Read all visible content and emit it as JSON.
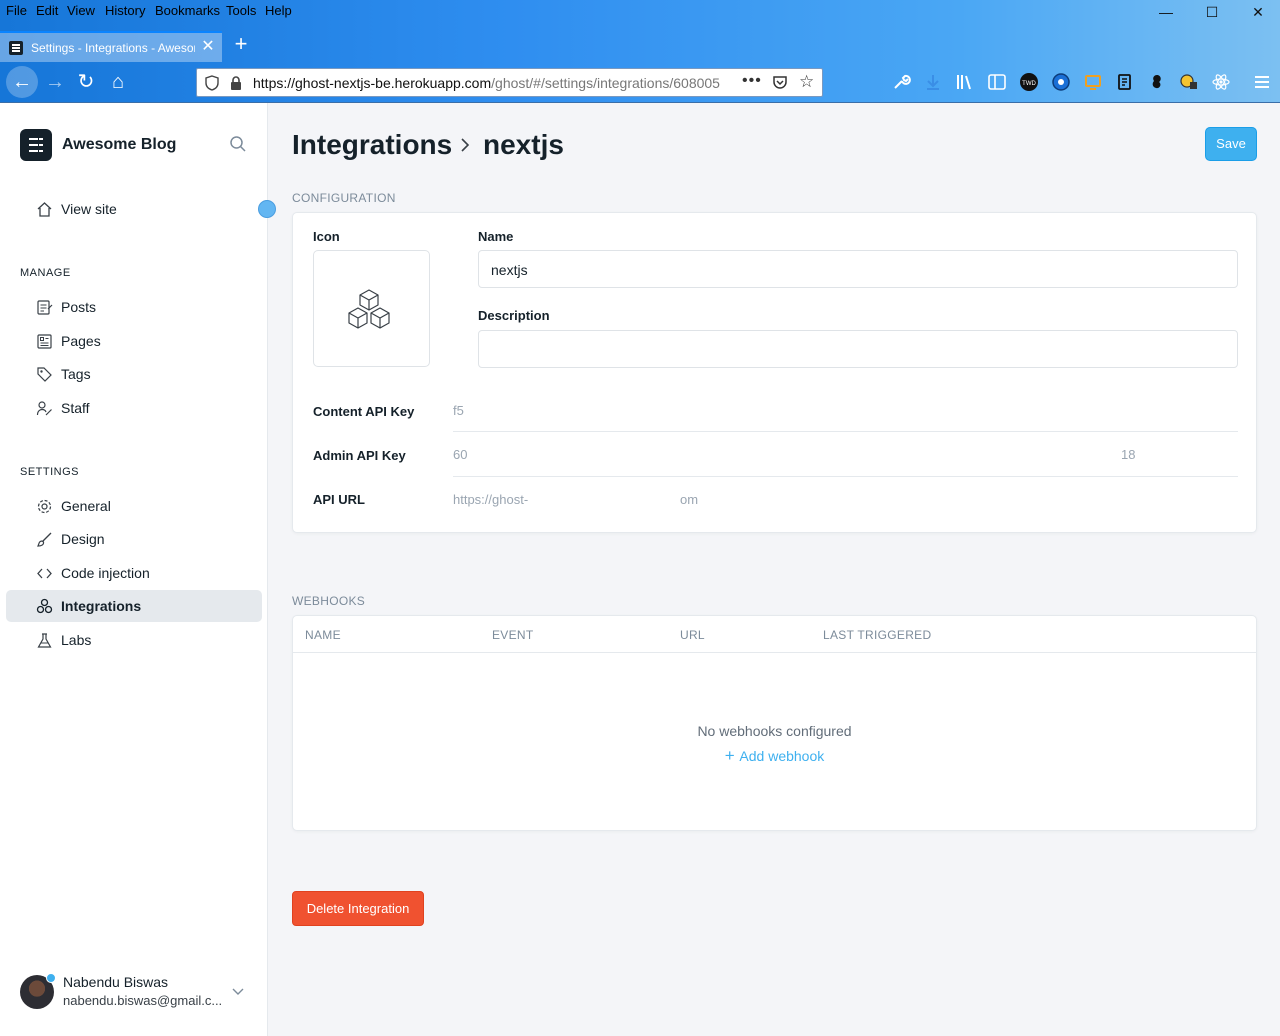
{
  "browser": {
    "menu": [
      "File",
      "Edit",
      "View",
      "History",
      "Bookmarks",
      "Tools",
      "Help"
    ],
    "tab_title": "Settings - Integrations - Awesome Blog",
    "url_host": "https://ghost-nextjs-be.herokuapp.com",
    "url_path": "/ghost/#/settings/integrations/608005",
    "colors": {
      "chrome": "#2f8ef0",
      "accent": "#0a84ff"
    }
  },
  "sidebar": {
    "brand": "Awesome Blog",
    "view_site": "View site",
    "manage_heading": "MANAGE",
    "manage_items": [
      {
        "label": "Posts",
        "icon": "posts-icon"
      },
      {
        "label": "Pages",
        "icon": "pages-icon"
      },
      {
        "label": "Tags",
        "icon": "tag-icon"
      },
      {
        "label": "Staff",
        "icon": "staff-icon"
      }
    ],
    "settings_heading": "SETTINGS",
    "settings_items": [
      {
        "label": "General",
        "icon": "gear-icon"
      },
      {
        "label": "Design",
        "icon": "brush-icon"
      },
      {
        "label": "Code injection",
        "icon": "code-icon"
      },
      {
        "label": "Integrations",
        "icon": "integrations-icon",
        "active": true
      },
      {
        "label": "Labs",
        "icon": "flask-icon"
      }
    ],
    "user": {
      "name": "Nabendu Biswas",
      "email": "nabendu.biswas@gmail.c..."
    }
  },
  "main": {
    "breadcrumb_parent": "Integrations",
    "breadcrumb_current": "nextjs",
    "save_label": "Save",
    "config_heading": "CONFIGURATION",
    "icon_label": "Icon",
    "name_label": "Name",
    "name_value": "nextjs",
    "description_label": "Description",
    "description_value": "",
    "content_key_label": "Content API Key",
    "content_key_value": "f5",
    "admin_key_label": "Admin API Key",
    "admin_key_value": "60",
    "admin_key_tail": "18",
    "api_url_label": "API URL",
    "api_url_value": "https://ghost-",
    "api_url_tail": "om",
    "webhooks_heading": "WEBHOOKS",
    "webhook_columns": [
      "NAME",
      "EVENT",
      "URL",
      "LAST TRIGGERED"
    ],
    "webhooks_empty": "No webhooks configured",
    "add_webhook": "Add webhook",
    "delete_label": "Delete Integration",
    "colors": {
      "accent": "#3eb0ef",
      "danger": "#f05230"
    }
  }
}
